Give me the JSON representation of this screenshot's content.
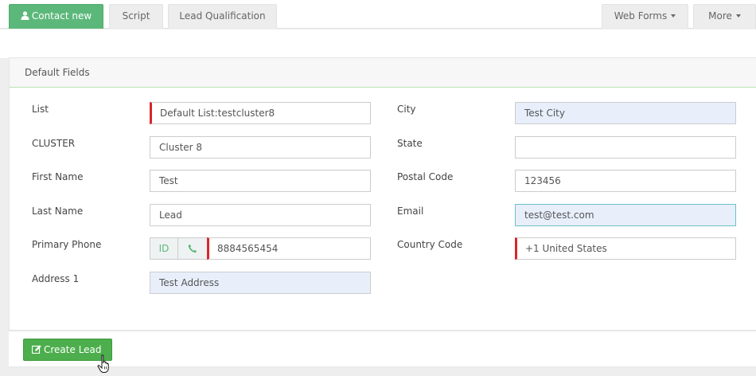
{
  "tabs": {
    "contact": "Contact new",
    "script": "Script",
    "lead_qualification": "Lead Qualification",
    "web_forms": "Web Forms",
    "more": "More"
  },
  "panel": {
    "title": "Default Fields"
  },
  "fields": {
    "list": {
      "label": "List",
      "value": "Default List:testcluster8"
    },
    "cluster": {
      "label": "CLUSTER",
      "value": "Cluster 8"
    },
    "first_name": {
      "label": "First Name",
      "value": "Test"
    },
    "last_name": {
      "label": "Last Name",
      "value": "Lead"
    },
    "primary_phone": {
      "label": "Primary Phone",
      "addon_id": "ID",
      "value": "8884565454"
    },
    "address1": {
      "label": "Address 1",
      "value": "Test Address"
    },
    "city": {
      "label": "City",
      "value": "Test City"
    },
    "state": {
      "label": "State",
      "value": ""
    },
    "postal_code": {
      "label": "Postal Code",
      "value": "123456"
    },
    "email": {
      "label": "Email",
      "value": "test@test.com"
    },
    "country_code": {
      "label": "Country Code",
      "value": "+1 United States"
    }
  },
  "actions": {
    "create_lead": "Create Lead"
  },
  "colors": {
    "active_tab": "#5cb87a",
    "required_marker": "#d9262c",
    "create_button": "#4cae4c"
  }
}
